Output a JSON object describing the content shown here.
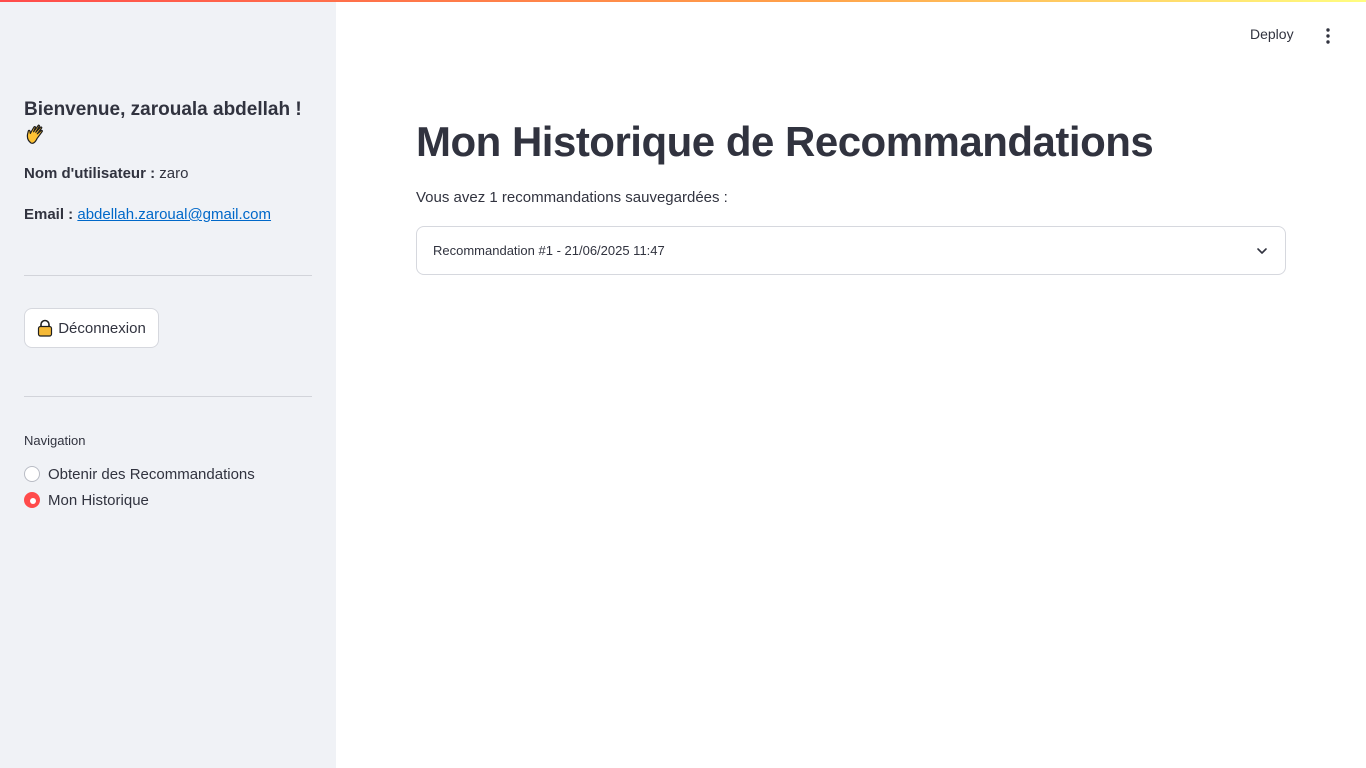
{
  "header": {
    "deploy_label": "Deploy"
  },
  "sidebar": {
    "welcome": "Bienvenue, zarouala abdellah !",
    "username_label": "Nom d'utilisateur :",
    "username_value": "zaro",
    "email_label": "Email :",
    "email_value": "abdellah.zaroual@gmail.com",
    "logout_label": "Déconnexion",
    "nav_title": "Navigation",
    "nav_options": [
      {
        "label": "Obtenir des Recommandations",
        "selected": false
      },
      {
        "label": "Mon Historique",
        "selected": true
      }
    ]
  },
  "main": {
    "title": "Mon Historique de Recommandations",
    "subtitle": "Vous avez 1 recommandations sauvegardées :",
    "expanders": [
      {
        "label": "Recommandation #1 - 21/06/2025 11:47",
        "expanded": false
      }
    ]
  },
  "colors": {
    "accent": "#ff4b4b",
    "link": "#0068c9",
    "sidebar_bg": "#f0f2f6",
    "text": "#31333f"
  },
  "icons": {
    "welcome": "waving-hand-icon",
    "logout": "lock-icon",
    "menu": "kebab-menu-icon",
    "expander": "chevron-down-icon"
  }
}
